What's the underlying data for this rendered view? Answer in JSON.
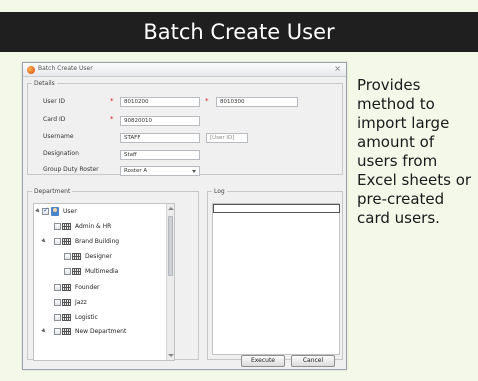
{
  "banner": {
    "title": "Batch Create User"
  },
  "dialog": {
    "title": "Batch Create User",
    "details": {
      "legend": "Details",
      "user_id_label": "User ID",
      "user_id_from": "8010200",
      "user_id_to": "8010300",
      "card_id_label": "Card ID",
      "card_id": "90820010",
      "username_label": "Username",
      "username": "STAFF",
      "username_suffix": "[User ID]",
      "designation_label": "Designation",
      "designation": "Staff",
      "roster_label": "Group Duty Roster",
      "roster": "Roster A",
      "required_mark": "*"
    },
    "department": {
      "legend": "Department",
      "nodes": [
        {
          "label": "User",
          "checked": true
        },
        {
          "label": "Admin & HR",
          "checked": false
        },
        {
          "label": "Brand Building",
          "checked": false
        },
        {
          "label": "Designer",
          "checked": false
        },
        {
          "label": "Multimedia",
          "checked": false
        },
        {
          "label": "Founder",
          "checked": false
        },
        {
          "label": "Jazz",
          "checked": false
        },
        {
          "label": "Logistic",
          "checked": false
        },
        {
          "label": "New Department",
          "checked": false
        }
      ]
    },
    "log": {
      "legend": "Log"
    },
    "buttons": {
      "execute": "Execute",
      "cancel": "Cancel"
    }
  },
  "description": "Provides method to import large amount of users from Excel sheets or pre-created card users.",
  "icons": {
    "app": "app-icon",
    "close": "close-icon",
    "dropdown": "chevron-down-icon",
    "department": "building-icon",
    "user_group": "user-group-icon"
  }
}
